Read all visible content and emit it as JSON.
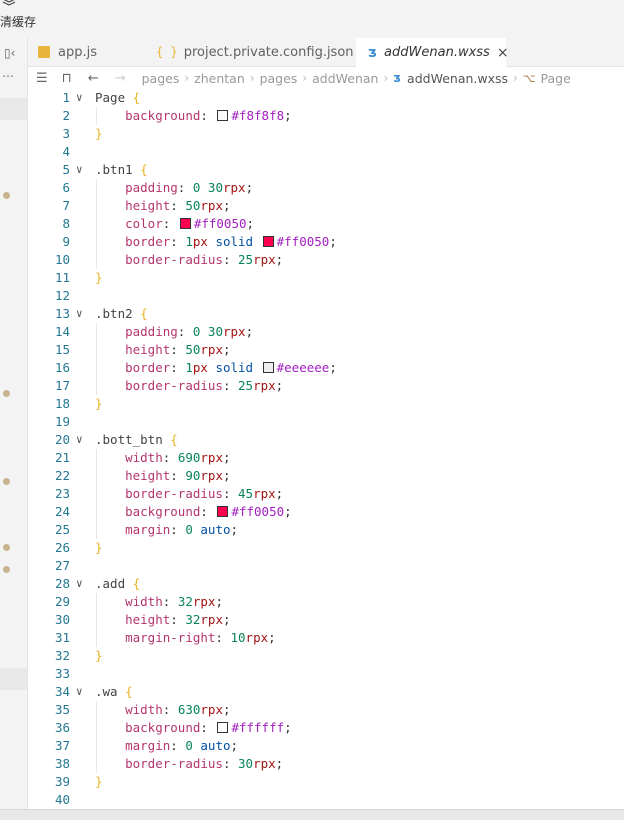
{
  "top": {
    "cache_label": "清缓存"
  },
  "tabs": [
    {
      "label": "app.js",
      "icon": "js-icon"
    },
    {
      "label": "project.private.config.json",
      "icon": "json-icon"
    },
    {
      "label": "addWenan.wxss",
      "icon": "css-icon",
      "active": true
    }
  ],
  "breadcrumb": [
    "pages",
    "zhentan",
    "pages",
    "addWenan",
    "addWenan.wxss",
    "Page"
  ],
  "colors": {
    "swatch_f8": "#f8f8f8",
    "swatch_ff": "#ff0050",
    "swatch_ee": "#eeeeee",
    "swatch_fff": "#ffffff"
  },
  "code": [
    "Page {",
    "    background: #f8f8f8;",
    "}",
    "",
    ".btn1 {",
    "    padding: 0 30rpx;",
    "    height: 50rpx;",
    "    color: #ff0050;",
    "    border: 1px solid #ff0050;",
    "    border-radius: 25rpx;",
    "}",
    "",
    ".btn2 {",
    "    padding: 0 30rpx;",
    "    height: 50rpx;",
    "    border: 1px solid #eeeeee;",
    "    border-radius: 25rpx;",
    "}",
    "",
    ".bott_btn {",
    "    width: 690rpx;",
    "    height: 90rpx;",
    "    border-radius: 45rpx;",
    "    background: #ff0050;",
    "    margin: 0 auto;",
    "}",
    "",
    ".add {",
    "    width: 32rpx;",
    "    height: 32rpx;",
    "    margin-right: 10rpx;",
    "}",
    "",
    ".wa {",
    "    width: 630rpx;",
    "    background: #ffffff;",
    "    margin: 0 auto;",
    "    border-radius: 30rpx;",
    "}",
    ""
  ]
}
